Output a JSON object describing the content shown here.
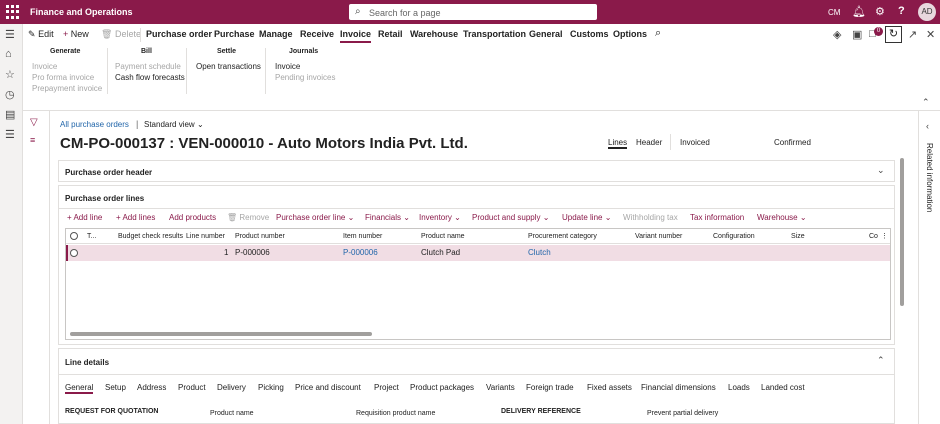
{
  "topbar": {
    "app_title": "Finance and Operations",
    "search_placeholder": "Search for a page",
    "company": "CM",
    "avatar": "AD",
    "icons": [
      "search-icon",
      "bell-icon",
      "gear-icon",
      "help-icon",
      "avatar"
    ]
  },
  "actionpane": {
    "buttons": {
      "edit": "Edit",
      "new": "New",
      "delete": "Delete"
    },
    "tabs": [
      "Purchase order",
      "Purchase",
      "Manage",
      "Receive",
      "Invoice",
      "Retail",
      "Warehouse",
      "Transportation",
      "General",
      "Customs",
      "Options"
    ],
    "active_tab": "Invoice",
    "groups": [
      {
        "title": "Generate",
        "items": [
          {
            "label": "Invoice",
            "enabled": false
          },
          {
            "label": "Pro forma invoice",
            "enabled": false
          },
          {
            "label": "Prepayment invoice",
            "enabled": false
          }
        ]
      },
      {
        "title": "Bill",
        "items": [
          {
            "label": "Payment schedule",
            "enabled": false
          },
          {
            "label": "Cash flow forecasts",
            "enabled": true
          }
        ]
      },
      {
        "title": "Settle",
        "items": [
          {
            "label": "Open transactions",
            "enabled": true
          }
        ]
      },
      {
        "title": "Journals",
        "items": [
          {
            "label": "Invoice",
            "enabled": true
          },
          {
            "label": "Pending invoices",
            "enabled": false
          }
        ]
      }
    ],
    "notification_count": "0"
  },
  "page": {
    "breadcrumb": "All purchase orders",
    "view": "Standard view",
    "title": "CM-PO-000137 : VEN-000010 - Auto Motors India Pvt. Ltd.",
    "header_tabs": [
      "Lines",
      "Header"
    ],
    "active_header_tab": "Lines",
    "status_invoiced": "Invoiced",
    "status_confirmed": "Confirmed"
  },
  "fasttabs": {
    "po_header": "Purchase order header",
    "po_lines": "Purchase order lines",
    "line_details": "Line details"
  },
  "lines_toolbar": [
    {
      "label": "Add line",
      "enabled": true,
      "plus": true
    },
    {
      "label": "Add lines",
      "enabled": true,
      "plus": true
    },
    {
      "label": "Add products",
      "enabled": true
    },
    {
      "label": "Remove",
      "enabled": false
    },
    {
      "label": "Purchase order line",
      "enabled": true,
      "dropdown": true
    },
    {
      "label": "Financials",
      "enabled": true,
      "dropdown": true
    },
    {
      "label": "Inventory",
      "enabled": true,
      "dropdown": true
    },
    {
      "label": "Product and supply",
      "enabled": true,
      "dropdown": true
    },
    {
      "label": "Update line",
      "enabled": true,
      "dropdown": true
    },
    {
      "label": "Withholding tax",
      "enabled": false
    },
    {
      "label": "Tax information",
      "enabled": true
    },
    {
      "label": "Warehouse",
      "enabled": true,
      "dropdown": true
    }
  ],
  "grid": {
    "columns": [
      "T...",
      "Budget check results",
      "Line number",
      "Product number",
      "Item number",
      "Product name",
      "Procurement category",
      "Variant number",
      "Configuration",
      "Size",
      "Co"
    ],
    "rows": [
      {
        "line_number": "1",
        "product_number": "P-000006",
        "item_number": "P-000006",
        "product_name": "Clutch Pad",
        "procurement_category": "Clutch"
      }
    ]
  },
  "line_details": {
    "tabs": [
      "General",
      "Setup",
      "Address",
      "Product",
      "Delivery",
      "Picking",
      "Price and discount",
      "Project",
      "Product packages",
      "Variants",
      "Foreign trade",
      "Fixed assets",
      "Financial dimensions",
      "Loads",
      "Landed cost"
    ],
    "active_tab": "General",
    "fields": {
      "rfq_section": "REQUEST FOR QUOTATION",
      "product_name": "Product name",
      "requisition_product_name": "Requisition product name",
      "delivery_reference": "DELIVERY REFERENCE",
      "prevent_partial_delivery": "Prevent partial delivery"
    }
  },
  "related_panel": "Related information",
  "colors": {
    "brand": "#8a1a4a",
    "selected_row": "#f1dde4",
    "link": "#2266aa"
  }
}
